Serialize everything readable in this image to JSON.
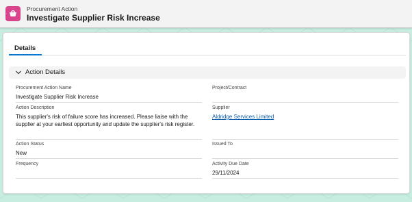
{
  "header": {
    "object_type": "Procurement Action",
    "title": "Investigate Supplier Risk Increase"
  },
  "tabs": [
    {
      "label": "Details",
      "active": true
    }
  ],
  "section": {
    "title": "Action Details",
    "expanded": true
  },
  "fields": {
    "action_name": {
      "label": "Procurement Action Name",
      "value": "Investigate Supplier Risk Increase"
    },
    "project": {
      "label": "Project/Contract",
      "value": ""
    },
    "description": {
      "label": "Action Description",
      "value": "This supplier's risk of failure score has increased. Please liaise with the supplier at your earliest opportunity and update the supplier's risk register."
    },
    "supplier": {
      "label": "Supplier",
      "value": "Aldridge Services Limited"
    },
    "status": {
      "label": "Action Status",
      "value": "New"
    },
    "issued_to": {
      "label": "Issued To",
      "value": ""
    },
    "frequency": {
      "label": "Frequency",
      "value": ""
    },
    "due_date": {
      "label": "Activity Due Date",
      "value": "29/11/2024"
    }
  },
  "colors": {
    "background": "#c7ece0",
    "icon": "#d9458c",
    "tab_accent": "#0176d3",
    "link": "#0b5cab"
  },
  "icons": {
    "object_icon": "procurement-action-icon",
    "section_chevron": "chevron-down-icon"
  }
}
